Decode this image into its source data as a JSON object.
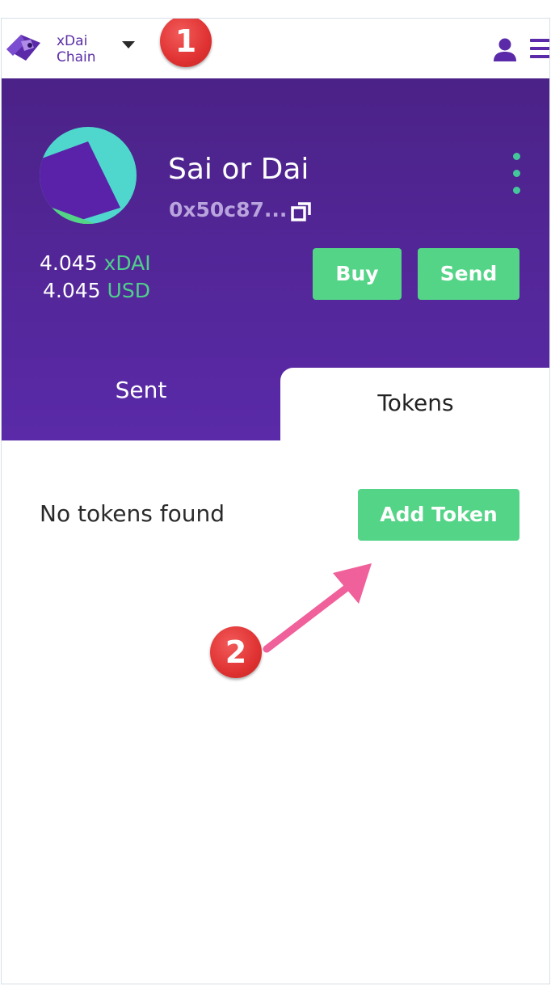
{
  "header": {
    "network_line1": "xDai",
    "network_line2": "Chain",
    "logo_icon": "wallet-logo-icon",
    "user_icon": "user-icon",
    "menu_icon": "hamburger-menu-icon"
  },
  "account": {
    "name": "Sai or Dai",
    "address": "0x50c87...",
    "copy_icon": "copy-icon",
    "more_icon": "kebab-menu-icon"
  },
  "balances": [
    {
      "amount": "4.045",
      "unit": "xDAI"
    },
    {
      "amount": "4.045",
      "unit": "USD"
    }
  ],
  "actions": {
    "buy_label": "Buy",
    "send_label": "Send"
  },
  "tabs": [
    {
      "label": "Sent",
      "active": false
    },
    {
      "label": "Tokens",
      "active": true
    }
  ],
  "tokens_panel": {
    "empty_text": "No tokens found",
    "add_token_label": "Add Token"
  },
  "annotations": {
    "step1": "1",
    "step2": "2"
  },
  "colors": {
    "brand_purple": "#5a2aa8",
    "accent_green": "#54d487",
    "annotation_red": "#e03232",
    "arrow_pink": "#f0609a"
  }
}
